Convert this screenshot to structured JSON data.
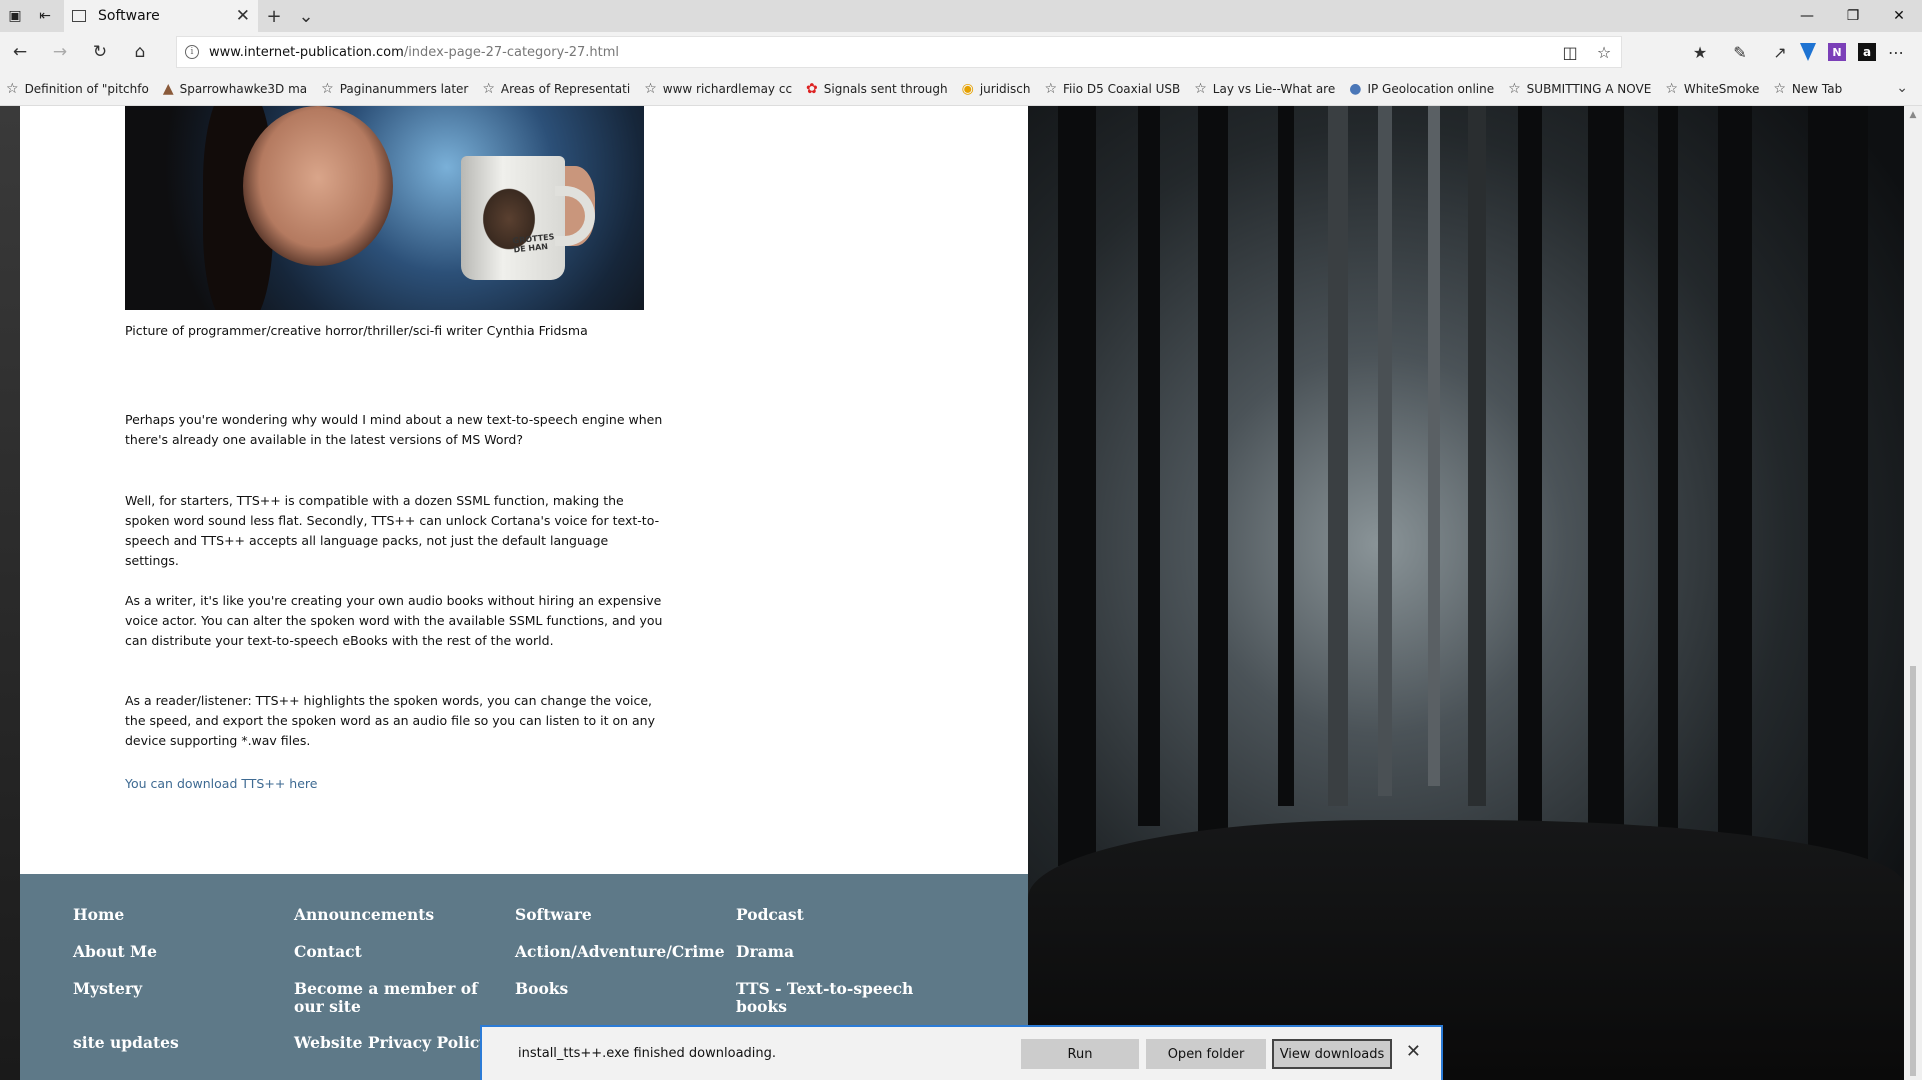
{
  "browser": {
    "tab": {
      "title": "Software"
    },
    "address": {
      "host": "www.internet-publication.com",
      "path": "/index-page-27-category-27.html"
    },
    "favorites": [
      {
        "label": "Definition of \"pitchfo",
        "icon": "star-icon"
      },
      {
        "label": "Sparrowhawke3D ma",
        "icon": "bird-icon"
      },
      {
        "label": "Paginanummers later",
        "icon": "star-icon"
      },
      {
        "label": "Areas of Representati",
        "icon": "star-icon"
      },
      {
        "label": "www richardlemay cc",
        "icon": "star-icon"
      },
      {
        "label": "Signals sent through",
        "icon": "maple-icon"
      },
      {
        "label": "juridisch",
        "icon": "multicolor-icon"
      },
      {
        "label": "Fiio D5 Coaxial  USB",
        "icon": "star-icon"
      },
      {
        "label": "Lay vs  Lie--What are",
        "icon": "star-icon"
      },
      {
        "label": "IP Geolocation online",
        "icon": "globe-icon"
      },
      {
        "label": "SUBMITTING A NOVE",
        "icon": "star-icon"
      },
      {
        "label": "WhiteSmoke",
        "icon": "star-icon"
      },
      {
        "label": "New Tab",
        "icon": "star-icon"
      }
    ]
  },
  "article": {
    "caption": "Picture of programmer/creative horror/thriller/sci-fi writer Cynthia Fridsma",
    "paragraphs": [
      "Perhaps you're wondering why would I mind about a new text-to-speech engine when there's already one available in the latest versions of MS Word?",
      "Well, for starters, TTS++ is compatible with a dozen SSML function, making the spoken word sound less flat. Secondly, TTS++ can unlock Cortana's voice for text-to-speech and TTS++ accepts all language packs, not just the default language settings.",
      "As a writer, it's like you're creating your own audio books without hiring an expensive voice actor. You can alter the spoken word with the available SSML functions, and you can distribute your text-to-speech eBooks with the rest of the world.",
      "As a reader/listener: TTS++ highlights the spoken words, you can change the voice, the speed, and export the spoken word as an audio file so you can listen to it on any device supporting *.wav files."
    ],
    "download_link": "You can download TTS++ here",
    "photo_mug_text": "GROTTES DE HAN"
  },
  "footer": {
    "links": [
      "Home",
      "Announcements",
      "Software",
      "Podcast",
      "About Me",
      "Contact",
      "Action/Adventure/Crime",
      "Drama",
      "Mystery",
      "Become a member of our site",
      "Books",
      "TTS - Text-to-speech books",
      "site updates",
      "Website Privacy Policy"
    ]
  },
  "download": {
    "message": "install_tts++.exe finished downloading.",
    "run": "Run",
    "open_folder": "Open folder",
    "view_downloads": "View downloads"
  }
}
